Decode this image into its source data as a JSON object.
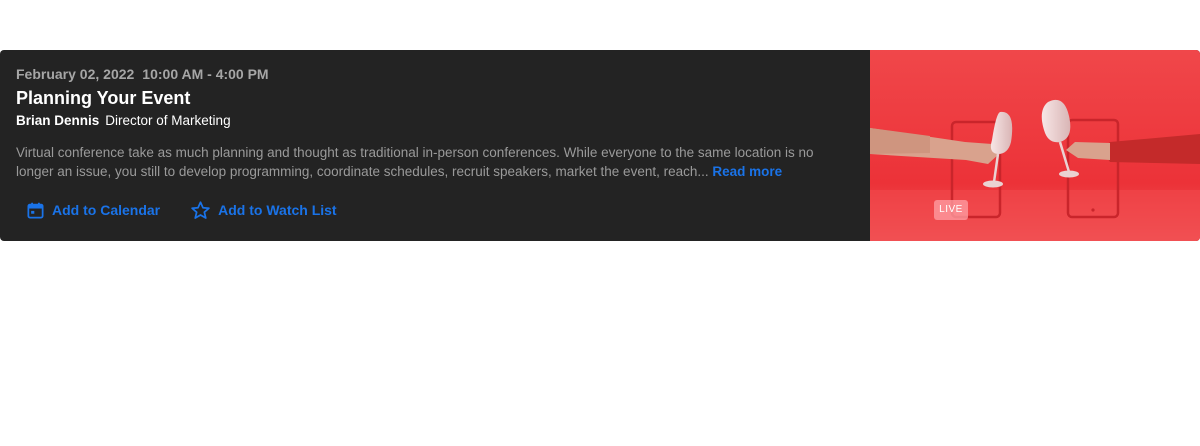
{
  "event": {
    "date": "February 02, 2022",
    "time": "10:00 AM - 4:00 PM",
    "title": "Planning Your Event",
    "speaker_name": "Brian Dennis",
    "speaker_role": "Director of Marketing",
    "description": "Virtual conference take as much planning and thought as traditional in-person conferences. While everyone to the same location is no longer an issue, you still to develop programming, coordinate schedules, recruit speakers, market the event, reach... ",
    "read_more_label": "Read more"
  },
  "actions": {
    "calendar_label": "Add to Calendar",
    "calendar_icon": "calendar-icon",
    "watchlist_label": "Add to Watch List",
    "watchlist_icon": "star-icon"
  },
  "media": {
    "badge": "LIVE"
  },
  "colors": {
    "card_bg": "#232323",
    "accent": "#1a73e8",
    "media_bg": "#ee3a40"
  }
}
